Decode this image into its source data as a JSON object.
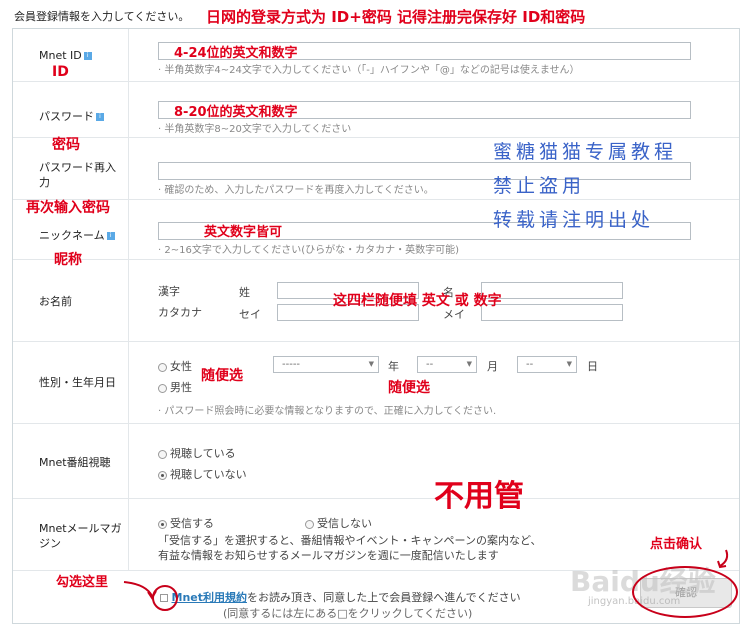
{
  "header": {
    "title": "会員登録情報を入力してください。",
    "annotation": "日网的登录方式为 ID+密码 记得注册完保存好 ID和密码"
  },
  "fields": {
    "mnet_id": {
      "label": "Mnet ID",
      "annotation": "4-24位的英文和数字",
      "label_annotation": "ID",
      "hint": "· 半角英数字4~24文字で入力してください（「-」ハイフンや「@」などの記号は使えません）"
    },
    "password": {
      "label": "パスワード",
      "annotation": "8-20位的英文和数字",
      "label_annotation": "密码",
      "hint": "· 半角英数字8~20文字で入力してください"
    },
    "password_confirm": {
      "label_line1": "パスワード再入",
      "label_line2": "力",
      "label_annotation": "再次输入密码",
      "hint": "· 確認のため、入力したパスワードを再度入力してください。"
    },
    "nickname": {
      "label": "ニックネーム",
      "annotation": "英文数字皆可",
      "label_annotation": "昵称",
      "hint": "· 2~16文字で入力してください(ひらがな・カタカナ・英数字可能)"
    },
    "name": {
      "label": "お名前",
      "kanji_label": "漢字",
      "katakana_label": "カタカナ",
      "sei_kanji": "姓",
      "sei_kana": "セイ",
      "mei_kanji": "名",
      "mei_kana": "メイ",
      "annotation": "这四栏随便填 英文 或 数字"
    },
    "gender_birth": {
      "label": "性別・生年月日",
      "female": "女性",
      "male": "男性",
      "year_value": "-----",
      "year_unit": "年",
      "month_value": "--",
      "month_unit": "月",
      "day_value": "--",
      "day_unit": "日",
      "annotation_gender": "随便选",
      "annotation_date": "随便选",
      "hint": "· パスワード照会時に必要な情報となりますので、正確に入力してください."
    },
    "program_view": {
      "label": "Mnet番組視聴",
      "option1": "視聴している",
      "option2": "視聴していない",
      "annotation": "不用管"
    },
    "magazine": {
      "label_line1": "Mnetメールマガ",
      "label_line2": "ジン",
      "option1": "受信する",
      "option2": "受信しない",
      "desc_line1": "「受信する」を選択すると、番組情報やイベント・キャンペーンの案内など、",
      "desc_line2": "有益な情報をお知らせするメールマガジンを週に一度配信いたします"
    }
  },
  "terms": {
    "link": "Mnet利用規約",
    "text": "をお読み頂き、同意した上で会員登録へ進んでください",
    "note": "(同意するには左にある□をクリックしてください)",
    "annotation": "勾选这里"
  },
  "confirm": {
    "label": "確認",
    "annotation": "点击确认"
  },
  "tutorial_overlay": {
    "line1": "蜜糖猫猫专属教程",
    "line2": "禁止盗用",
    "line3": "转载请注明出处"
  },
  "watermark": {
    "text": "Baidu经验",
    "sub": "jingyan.baidu.com"
  },
  "colors": {
    "annotation_red": "#e0001b",
    "overlay_blue": "#3a63c8",
    "link_blue": "#2a7ab8"
  }
}
